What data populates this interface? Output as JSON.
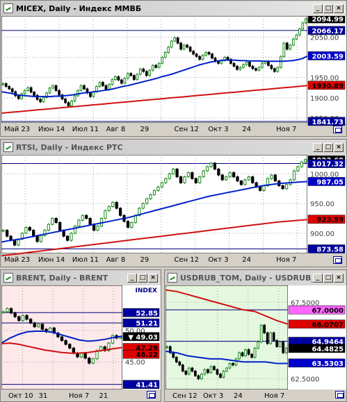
{
  "windows": {
    "micex": {
      "title": "MICEX, Daily - Индекс ММВБ"
    },
    "rtsi": {
      "title": "RTSI, Daily - Индекс РТС"
    },
    "brent": {
      "title": "BRENT, Daily - BRENT"
    },
    "usdrub": {
      "title": "USDRUB_TOM, Daily - USDRUB_..."
    }
  },
  "window_buttons": {
    "minimize": "_",
    "maximize": "□",
    "close": "×"
  },
  "colors": {
    "candle_up": "#1a8a1a",
    "candle_down": "#000000",
    "ma_fast": "#0020c8",
    "ma_slow": "#d01010",
    "brent_bg": "#fde8ea",
    "usdrub_bg": "#e4f8e0",
    "hline": "#000080"
  },
  "chart_data": [
    {
      "type": "candlestick",
      "instrument": "MICEX",
      "ylim": [
        1838,
        2102
      ],
      "y_ticks": [
        1850.0,
        1900.0,
        1950.0,
        2000.0,
        2050.0
      ],
      "x_ticks": [
        "Май 23",
        "Июн 14",
        "Июл 11",
        "Авг 8",
        "29",
        "Сен 12",
        "Окт 3",
        "24",
        "Ноя 7"
      ],
      "price_labels": [
        {
          "value": 2094.99,
          "text": "2094.99",
          "style": "current"
        },
        {
          "value": 2066.17,
          "text": "2066.17",
          "style": "line"
        },
        {
          "value": 2003.59,
          "text": "2003.59",
          "style": "blue"
        },
        {
          "value": 1930.89,
          "text": "1930.89",
          "style": "red"
        },
        {
          "value": 1841.73,
          "text": "1841.73",
          "style": "line"
        }
      ],
      "hlines": [
        2066.17,
        1841.73
      ],
      "closes": [
        1935,
        1928,
        1922,
        1915,
        1905,
        1898,
        1910,
        1918,
        1925,
        1914,
        1906,
        1896,
        1890,
        1901,
        1912,
        1924,
        1930,
        1918,
        1907,
        1897,
        1888,
        1880,
        1892,
        1905,
        1918,
        1930,
        1922,
        1912,
        1903,
        1915,
        1928,
        1938,
        1930,
        1920,
        1933,
        1945,
        1952,
        1944,
        1936,
        1948,
        1960,
        1955,
        1945,
        1958,
        1971,
        1965,
        1955,
        1968,
        1980,
        1975,
        1985,
        2000,
        2012,
        2025,
        2040,
        2048,
        2035,
        2020,
        2030,
        2025,
        2015,
        2008,
        2002,
        1995,
        2005,
        2012,
        2008,
        1998,
        1990,
        1985,
        1992,
        2000,
        1995,
        1985,
        1978,
        1970,
        1975,
        1982,
        1988,
        1978,
        1972,
        1968,
        1975,
        1985,
        1990,
        1980,
        1972,
        1965,
        1975,
        2002,
        2035,
        2020,
        2030,
        2045,
        2055,
        2070,
        2085,
        2095
      ],
      "ma_fast": [
        1915,
        1913,
        1911,
        1908,
        1906,
        1905,
        1904,
        1903,
        1903,
        1903,
        1903,
        1904,
        1904,
        1905,
        1906,
        1908,
        1910,
        1912,
        1913,
        1915,
        1916,
        1918,
        1920,
        1922,
        1925,
        1928,
        1930,
        1933,
        1936,
        1939,
        1942,
        1945,
        1948,
        1952,
        1955,
        1958,
        1962,
        1966,
        1970,
        1974,
        1978,
        1982,
        1985,
        1988,
        1990,
        1992,
        1993,
        1993,
        1993,
        1992,
        1992,
        1991,
        1991,
        1991,
        1990,
        1990,
        1990,
        1990,
        1990,
        1991,
        1992,
        1994,
        1997,
        2003
      ],
      "ma_slow": [
        1862,
        1864,
        1866,
        1868,
        1870,
        1872,
        1874,
        1876,
        1878,
        1880,
        1882,
        1884,
        1886,
        1888,
        1890,
        1892,
        1894,
        1896,
        1898,
        1900,
        1902,
        1904,
        1906,
        1908,
        1910,
        1912,
        1914,
        1916,
        1918,
        1920,
        1922,
        1924,
        1926,
        1928,
        1930
      ]
    },
    {
      "type": "candlestick",
      "instrument": "RTSI",
      "ylim": [
        866,
        1032
      ],
      "y_ticks": [
        900.0,
        950.0,
        1000.0
      ],
      "x_ticks": [
        "Май 23",
        "Июн 14",
        "Июл 11",
        "Авг 8",
        "29",
        "Сен 12",
        "Окт 3",
        "24",
        "Ноя 7"
      ],
      "price_labels": [
        {
          "value": 1023.6,
          "text": "1023.60",
          "style": "current"
        },
        {
          "value": 1017.32,
          "text": "1017.32",
          "style": "line"
        },
        {
          "value": 987.05,
          "text": "987.05",
          "style": "blue"
        },
        {
          "value": 923.59,
          "text": "923.59",
          "style": "red"
        },
        {
          "value": 873.58,
          "text": "873.58",
          "style": "line"
        }
      ],
      "hlines": [
        1017.32,
        873.58
      ],
      "closes": [
        905,
        895,
        888,
        880,
        890,
        900,
        910,
        905,
        895,
        886,
        896,
        905,
        915,
        925,
        918,
        905,
        895,
        888,
        900,
        912,
        922,
        930,
        925,
        915,
        905,
        912,
        925,
        938,
        945,
        952,
        942,
        930,
        920,
        910,
        918,
        930,
        942,
        950,
        958,
        965,
        972,
        978,
        985,
        992,
        1000,
        1008,
        995,
        985,
        995,
        1002,
        992,
        985,
        995,
        1005,
        1012,
        1018,
        1008,
        998,
        990,
        995,
        1002,
        995,
        988,
        982,
        990,
        995,
        985,
        978,
        972,
        980,
        992,
        998,
        988,
        980,
        975,
        982,
        990,
        1005,
        1012,
        1020,
        1024
      ],
      "ma_fast": [
        885,
        888,
        890,
        893,
        896,
        899,
        902,
        905,
        908,
        911,
        914,
        917,
        920,
        923,
        926,
        930,
        934,
        938,
        942,
        946,
        950,
        954,
        958,
        962,
        965,
        968,
        971,
        974,
        977,
        980,
        982,
        984,
        985,
        986,
        987
      ],
      "ma_slow": [
        862,
        865,
        868,
        871,
        874,
        877,
        880,
        883,
        886,
        889,
        892,
        895,
        898,
        901,
        904,
        907,
        910,
        913,
        916,
        919,
        921,
        923
      ]
    },
    {
      "type": "candlestick",
      "instrument": "BRENT",
      "ylim": [
        40.6,
        57.2
      ],
      "y_ticks": [
        45.0,
        50.0
      ],
      "x_ticks": [
        "Окт 10",
        "31",
        "Ноя 7",
        "21"
      ],
      "price_labels": [
        {
          "value": 52.85,
          "text": "52.85",
          "style": "line"
        },
        {
          "value": 51.21,
          "text": "51.21",
          "style": "line"
        },
        {
          "value": 49.03,
          "text": "49.03",
          "style": "current"
        },
        {
          "value": 47.29,
          "text": "47.29",
          "style": "red"
        },
        {
          "value": 46.22,
          "text": "46.22",
          "style": "red"
        },
        {
          "value": 41.41,
          "text": "41.41",
          "style": "line"
        }
      ],
      "index_label": "INDEX",
      "hlines": [
        52.85,
        51.21,
        41.41
      ],
      "closes": [
        53.0,
        53.5,
        52.8,
        52.2,
        51.6,
        52.4,
        51.8,
        51.2,
        50.6,
        51.0,
        50.2,
        49.8,
        50.4,
        49.6,
        49.0,
        48.4,
        47.8,
        47.2,
        46.4,
        45.8,
        46.4,
        45.6,
        44.8,
        45.5,
        46.8,
        47.4,
        46.8,
        48.0,
        49.2,
        48.8,
        49.0
      ],
      "ma_fast": [
        48.0,
        48.8,
        49.4,
        49.8,
        49.9,
        49.9,
        49.7,
        49.3,
        48.9,
        48.5,
        48.3,
        48.4,
        48.6,
        48.9,
        49.1
      ],
      "ma_slow": [
        47.9,
        48.0,
        47.8,
        47.5,
        47.2,
        46.9,
        46.7,
        46.5,
        46.4,
        46.4,
        46.5,
        46.7,
        46.9,
        47.1,
        47.3
      ]
    },
    {
      "type": "candlestick",
      "instrument": "USDRUB_TOM",
      "ylim": [
        61.8,
        68.6
      ],
      "y_ticks": [
        62.5,
        65.0,
        67.5
      ],
      "x_ticks": [
        "Сен 12",
        "Окт 3",
        "24",
        "Ноя 7"
      ],
      "price_labels": [
        {
          "value": 67.0,
          "text": "67.0000",
          "style": "magenta"
        },
        {
          "value": 66.0707,
          "text": "66.0707",
          "style": "red"
        },
        {
          "value": 64.9464,
          "text": "64.9464",
          "style": "line"
        },
        {
          "value": 64.4825,
          "text": "64.4825",
          "style": "current"
        },
        {
          "value": 63.5303,
          "text": "63.5303",
          "style": "blue"
        }
      ],
      "hlines": [
        67.0,
        64.9464
      ],
      "closes": [
        64.6,
        64.2,
        63.9,
        63.6,
        63.4,
        63.0,
        62.8,
        63.2,
        63.0,
        62.7,
        62.5,
        62.8,
        63.1,
        62.9,
        63.3,
        63.1,
        62.8,
        62.6,
        63.0,
        63.2,
        63.5,
        63.4,
        63.8,
        64.2,
        64.0,
        64.4,
        64.1,
        63.9,
        64.5,
        64.9,
        66.0,
        65.5,
        64.8,
        65.5,
        65.0,
        64.6,
        64.9,
        64.2,
        64.5
      ],
      "ma_fast": [
        64.3,
        64.2,
        64.0,
        63.9,
        63.8,
        63.8,
        63.7,
        63.6,
        63.6,
        63.6,
        63.5,
        63.5
      ],
      "ma_slow": [
        68.3,
        68.2,
        68.0,
        67.8,
        67.6,
        67.4,
        67.2,
        67.0,
        66.9,
        66.6,
        66.3,
        66.07
      ]
    }
  ]
}
